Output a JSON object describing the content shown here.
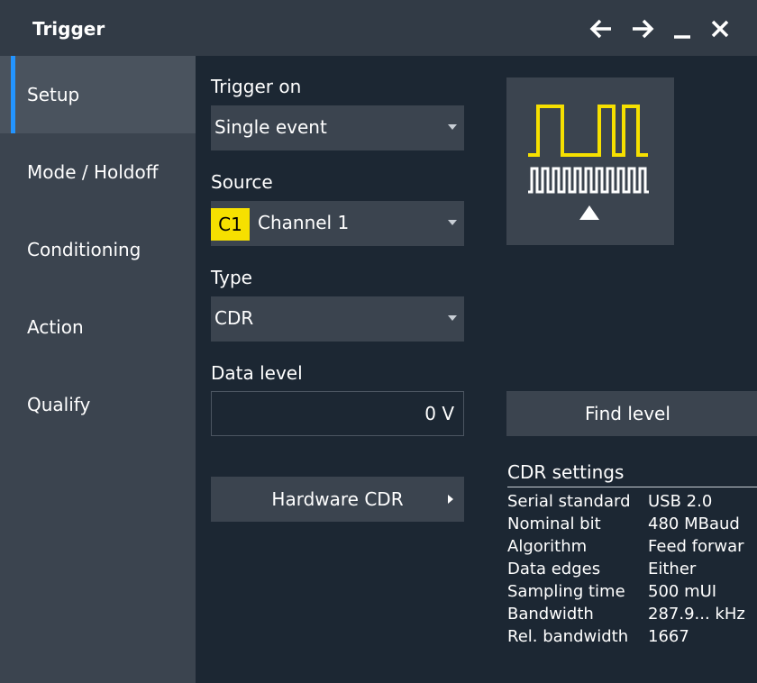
{
  "titlebar": {
    "title": "Trigger",
    "icons": [
      "arrow-left-icon",
      "arrow-right-icon",
      "minimize-icon",
      "close-icon"
    ]
  },
  "sidebar": {
    "items": [
      {
        "label": "Setup",
        "active": true
      },
      {
        "label": "Mode / Holdoff"
      },
      {
        "label": "Conditioning"
      },
      {
        "label": "Action"
      },
      {
        "label": "Qualify"
      }
    ]
  },
  "trigger_on": {
    "label": "Trigger on",
    "value": "Single event"
  },
  "source": {
    "label": "Source",
    "badge": "C1",
    "badge_color": "#f6e000",
    "value": "Channel 1"
  },
  "type": {
    "label": "Type",
    "value": "CDR"
  },
  "data_level": {
    "label": "Data level",
    "value": "0 V"
  },
  "buttons": {
    "find_level": "Find level",
    "hardware_cdr": "Hardware CDR"
  },
  "diagram": {
    "icon": "cdr-trigger-diagram-icon",
    "signal_color": "#f6e000"
  },
  "cdr_settings": {
    "title": "CDR settings",
    "rows": [
      {
        "key": "Serial standard",
        "value": "USB 2.0"
      },
      {
        "key": "Nominal bit",
        "value": "480 MBaud"
      },
      {
        "key": "Algorithm",
        "value": "Feed forwar"
      },
      {
        "key": "Data edges",
        "value": "Either"
      },
      {
        "key": "Sampling time",
        "value": "500 mUI"
      },
      {
        "key": "Bandwidth",
        "value": "287.9... kHz"
      },
      {
        "key": "Rel. bandwidth",
        "value": "1667"
      }
    ]
  },
  "colors": {
    "accent": "#2394ff",
    "background": "#1c2733",
    "panel": "#3b444f"
  }
}
